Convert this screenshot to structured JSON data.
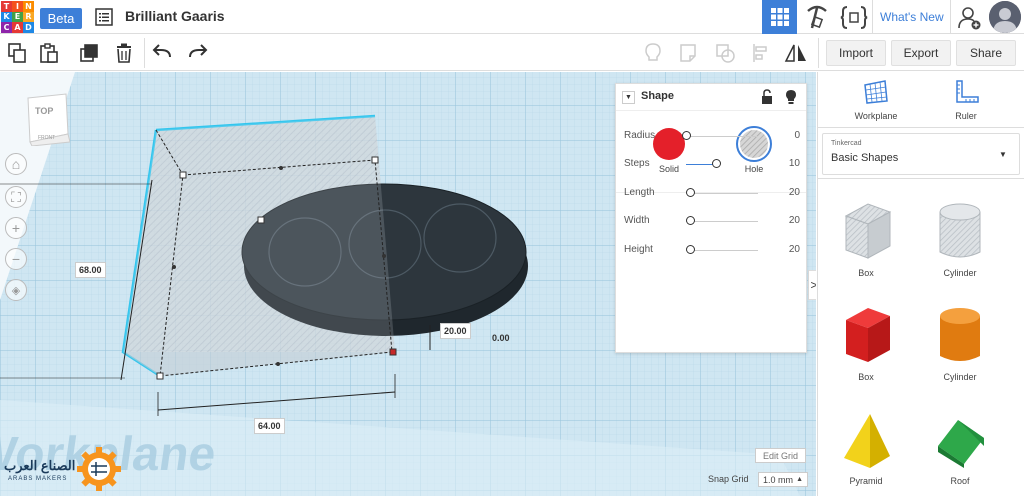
{
  "header": {
    "logo_letters": [
      "T",
      "I",
      "N",
      "K",
      "E",
      "R",
      "C",
      "A",
      "D"
    ],
    "logo_colors": [
      "#e53935",
      "#f4511e",
      "#fb8c00",
      "#1e88e5",
      "#43a047",
      "#fdd835",
      "#8e24aa",
      "#e53935",
      "#1e88e5"
    ],
    "beta_label": "Beta",
    "design_title": "Brilliant Gaaris",
    "whats_new": "What's New",
    "accent": "#3d7fd8"
  },
  "toolbar": {
    "import_label": "Import",
    "export_label": "Export",
    "share_label": "Share"
  },
  "viewcube": {
    "top": "TOP",
    "front": "FRONT"
  },
  "shape_panel": {
    "title": "Shape",
    "solid_label": "Solid",
    "hole_label": "Hole",
    "solid_color": "#e4202a",
    "params": [
      {
        "label": "Radius",
        "value": "0",
        "fraction": 0.0
      },
      {
        "label": "Steps",
        "value": "10",
        "fraction": 0.42
      },
      {
        "label": "Length",
        "value": "20",
        "fraction": 0.05
      },
      {
        "label": "Width",
        "value": "20",
        "fraction": 0.05
      },
      {
        "label": "Height",
        "value": "20",
        "fraction": 0.05
      }
    ]
  },
  "dimensions": {
    "height": "68.00",
    "width": "64.00",
    "depth": "20.00",
    "elevation": "0.00"
  },
  "workplane_text": "Workplane",
  "grid": {
    "edit_label": "Edit Grid",
    "snap_label": "Snap Grid",
    "snap_value": "1.0 mm"
  },
  "watermark": {
    "arabic": "الصناع العرب",
    "latin": "ARABS MAKERS"
  },
  "right_panel": {
    "workplane_label": "Workplane",
    "ruler_label": "Ruler",
    "library_source": "Tinkercad",
    "library_name": "Basic Shapes",
    "shapes": [
      {
        "label": "Box",
        "icon": "box-hole-icon"
      },
      {
        "label": "Cylinder",
        "icon": "cylinder-hole-icon"
      },
      {
        "label": "Box",
        "icon": "box-red-icon"
      },
      {
        "label": "Cylinder",
        "icon": "cylinder-orange-icon"
      },
      {
        "label": "Pyramid",
        "icon": "pyramid-yellow-icon"
      },
      {
        "label": "Roof",
        "icon": "roof-green-icon"
      }
    ]
  }
}
